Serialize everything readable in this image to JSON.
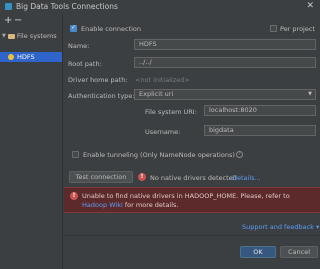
{
  "window": {
    "title": "Big Data Tools Connections",
    "close_glyph": "✕"
  },
  "toolbar": {
    "add_glyph": "+",
    "remove_glyph": "−"
  },
  "tree": {
    "group_label": "File systems",
    "items": [
      {
        "label": "HDFS"
      }
    ]
  },
  "form": {
    "enable_connection_label": "Enable connection",
    "enable_connection_checked": true,
    "per_project_label": "Per project",
    "per_project_checked": false,
    "name_label": "Name:",
    "name_value": "HDFS",
    "root_path_label": "Root path:",
    "root_path_value": "../../",
    "driver_home_label": "Driver home path:",
    "driver_home_value": "<not initialized>",
    "auth_type_label": "Authentication type:",
    "auth_type_value": "Explicit uri",
    "fs_uri_label": "File system URI:",
    "fs_uri_value": "localhost:8020",
    "username_label": "Username:",
    "username_value": "bigdata",
    "tunneling_label": "Enable tunneling (Only NameNode operations)",
    "tunneling_checked": false
  },
  "test": {
    "button_label": "Test connection",
    "status_text": "No native drivers detected",
    "details_link": "Details..."
  },
  "error": {
    "text_before": "Unable to find native drivers in HADOOP_HOME. Please, refer to ",
    "link_text": "Hadoop Wiki",
    "text_after": " for more details."
  },
  "footer": {
    "support_link": "Support and feedback",
    "ok_label": "OK",
    "cancel_label": "Cancel"
  },
  "colors": {
    "background": "#3c3f41",
    "selection": "#2f65ca",
    "link": "#589df6",
    "error_bg": "#5c2a2b",
    "error_icon": "#c75450"
  }
}
